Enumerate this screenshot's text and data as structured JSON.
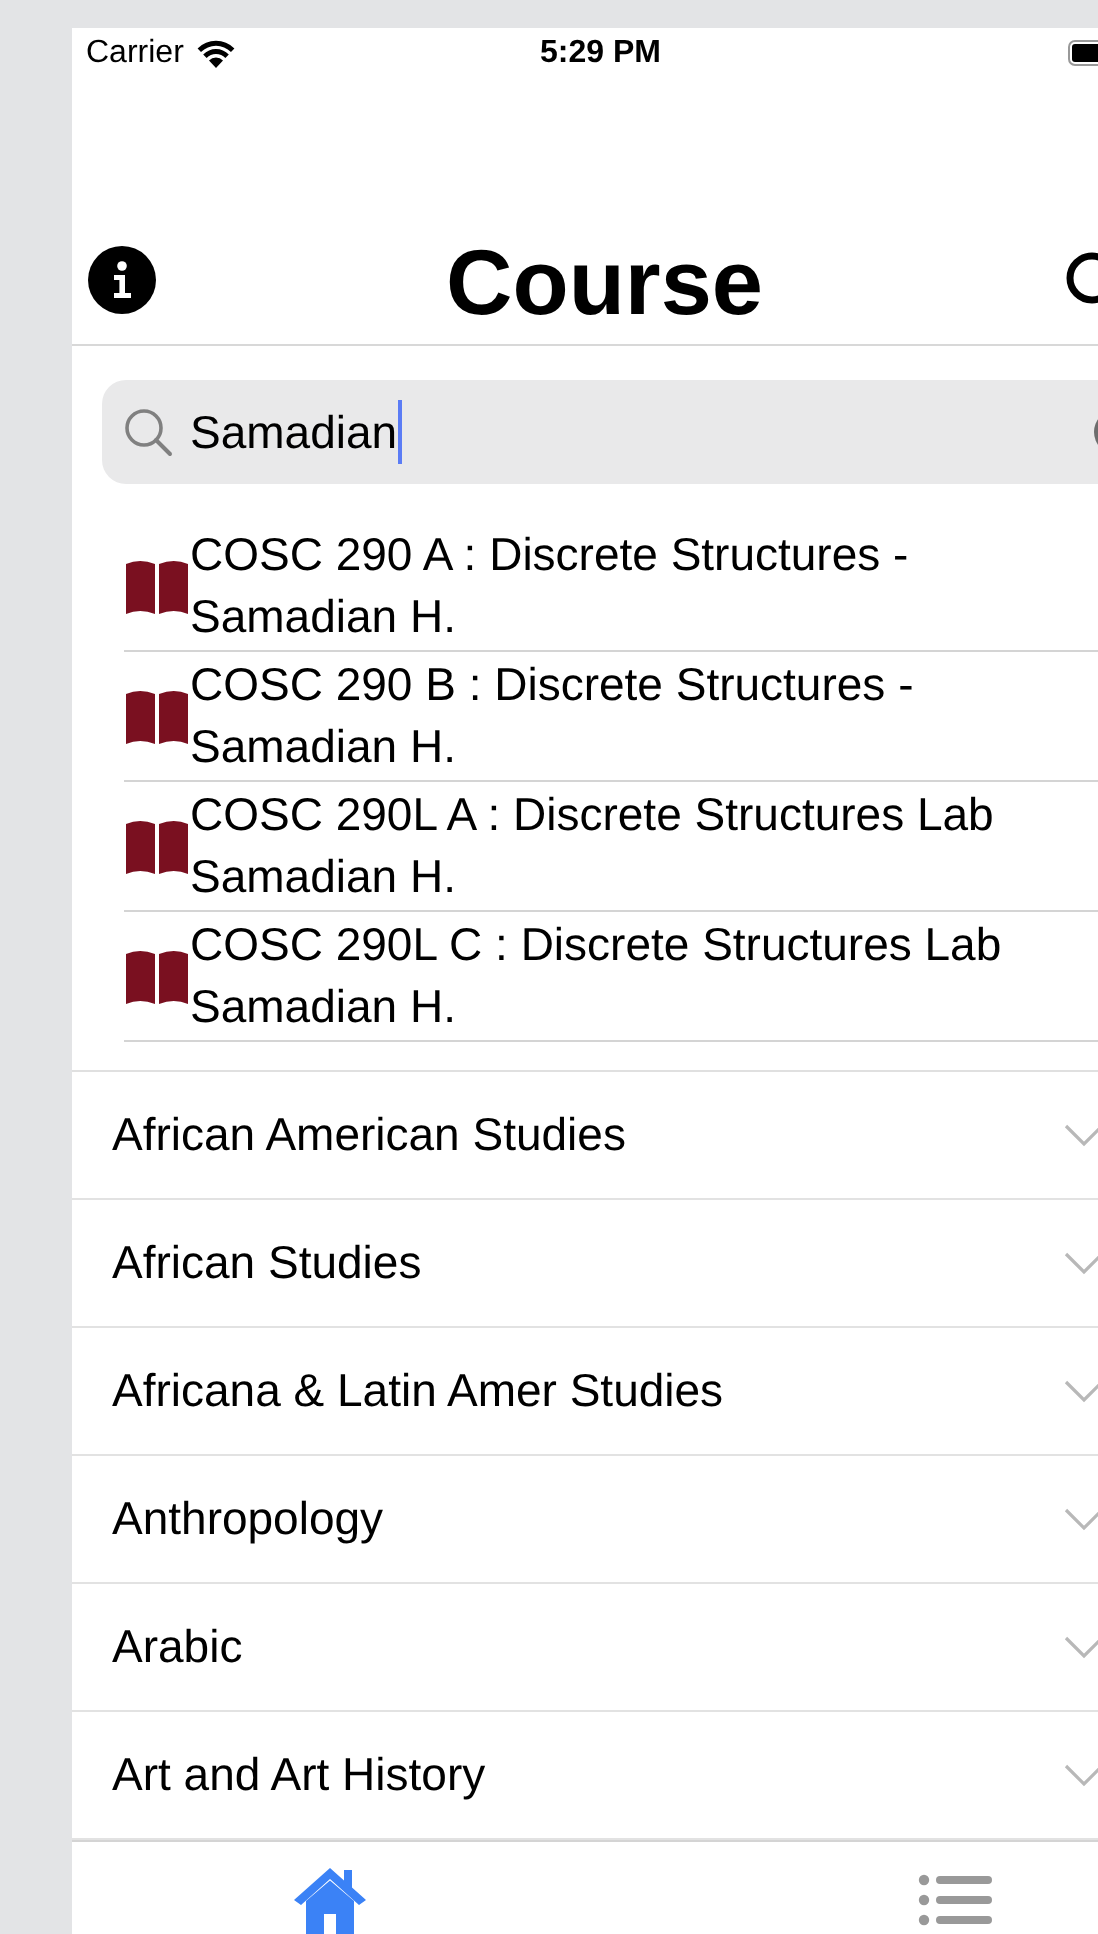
{
  "status_bar": {
    "carrier": "Carrier",
    "time": "5:29 PM"
  },
  "nav": {
    "title": "Course"
  },
  "search": {
    "value": "Samadian"
  },
  "results": [
    {
      "course": "COSC 290 A : Discrete Structures -",
      "instructor": "Samadian H."
    },
    {
      "course": "COSC 290 B : Discrete Structures -",
      "instructor": "Samadian H."
    },
    {
      "course": "COSC 290L A : Discrete Structures Lab",
      "instructor": "Samadian H."
    },
    {
      "course": "COSC 290L C : Discrete Structures Lab",
      "instructor": "Samadian H."
    }
  ],
  "departments": [
    {
      "name": "African American Studies",
      "expanded": false
    },
    {
      "name": "African Studies",
      "expanded": false
    },
    {
      "name": "Africana & Latin Amer Studies",
      "expanded": false
    },
    {
      "name": "Anthropology",
      "expanded": false
    },
    {
      "name": "Arabic",
      "expanded": false
    },
    {
      "name": "Art and Art History",
      "expanded": false
    }
  ],
  "tab_bar": [
    {
      "kind": "home",
      "selected": true
    },
    {
      "kind": "list",
      "selected": false
    }
  ]
}
